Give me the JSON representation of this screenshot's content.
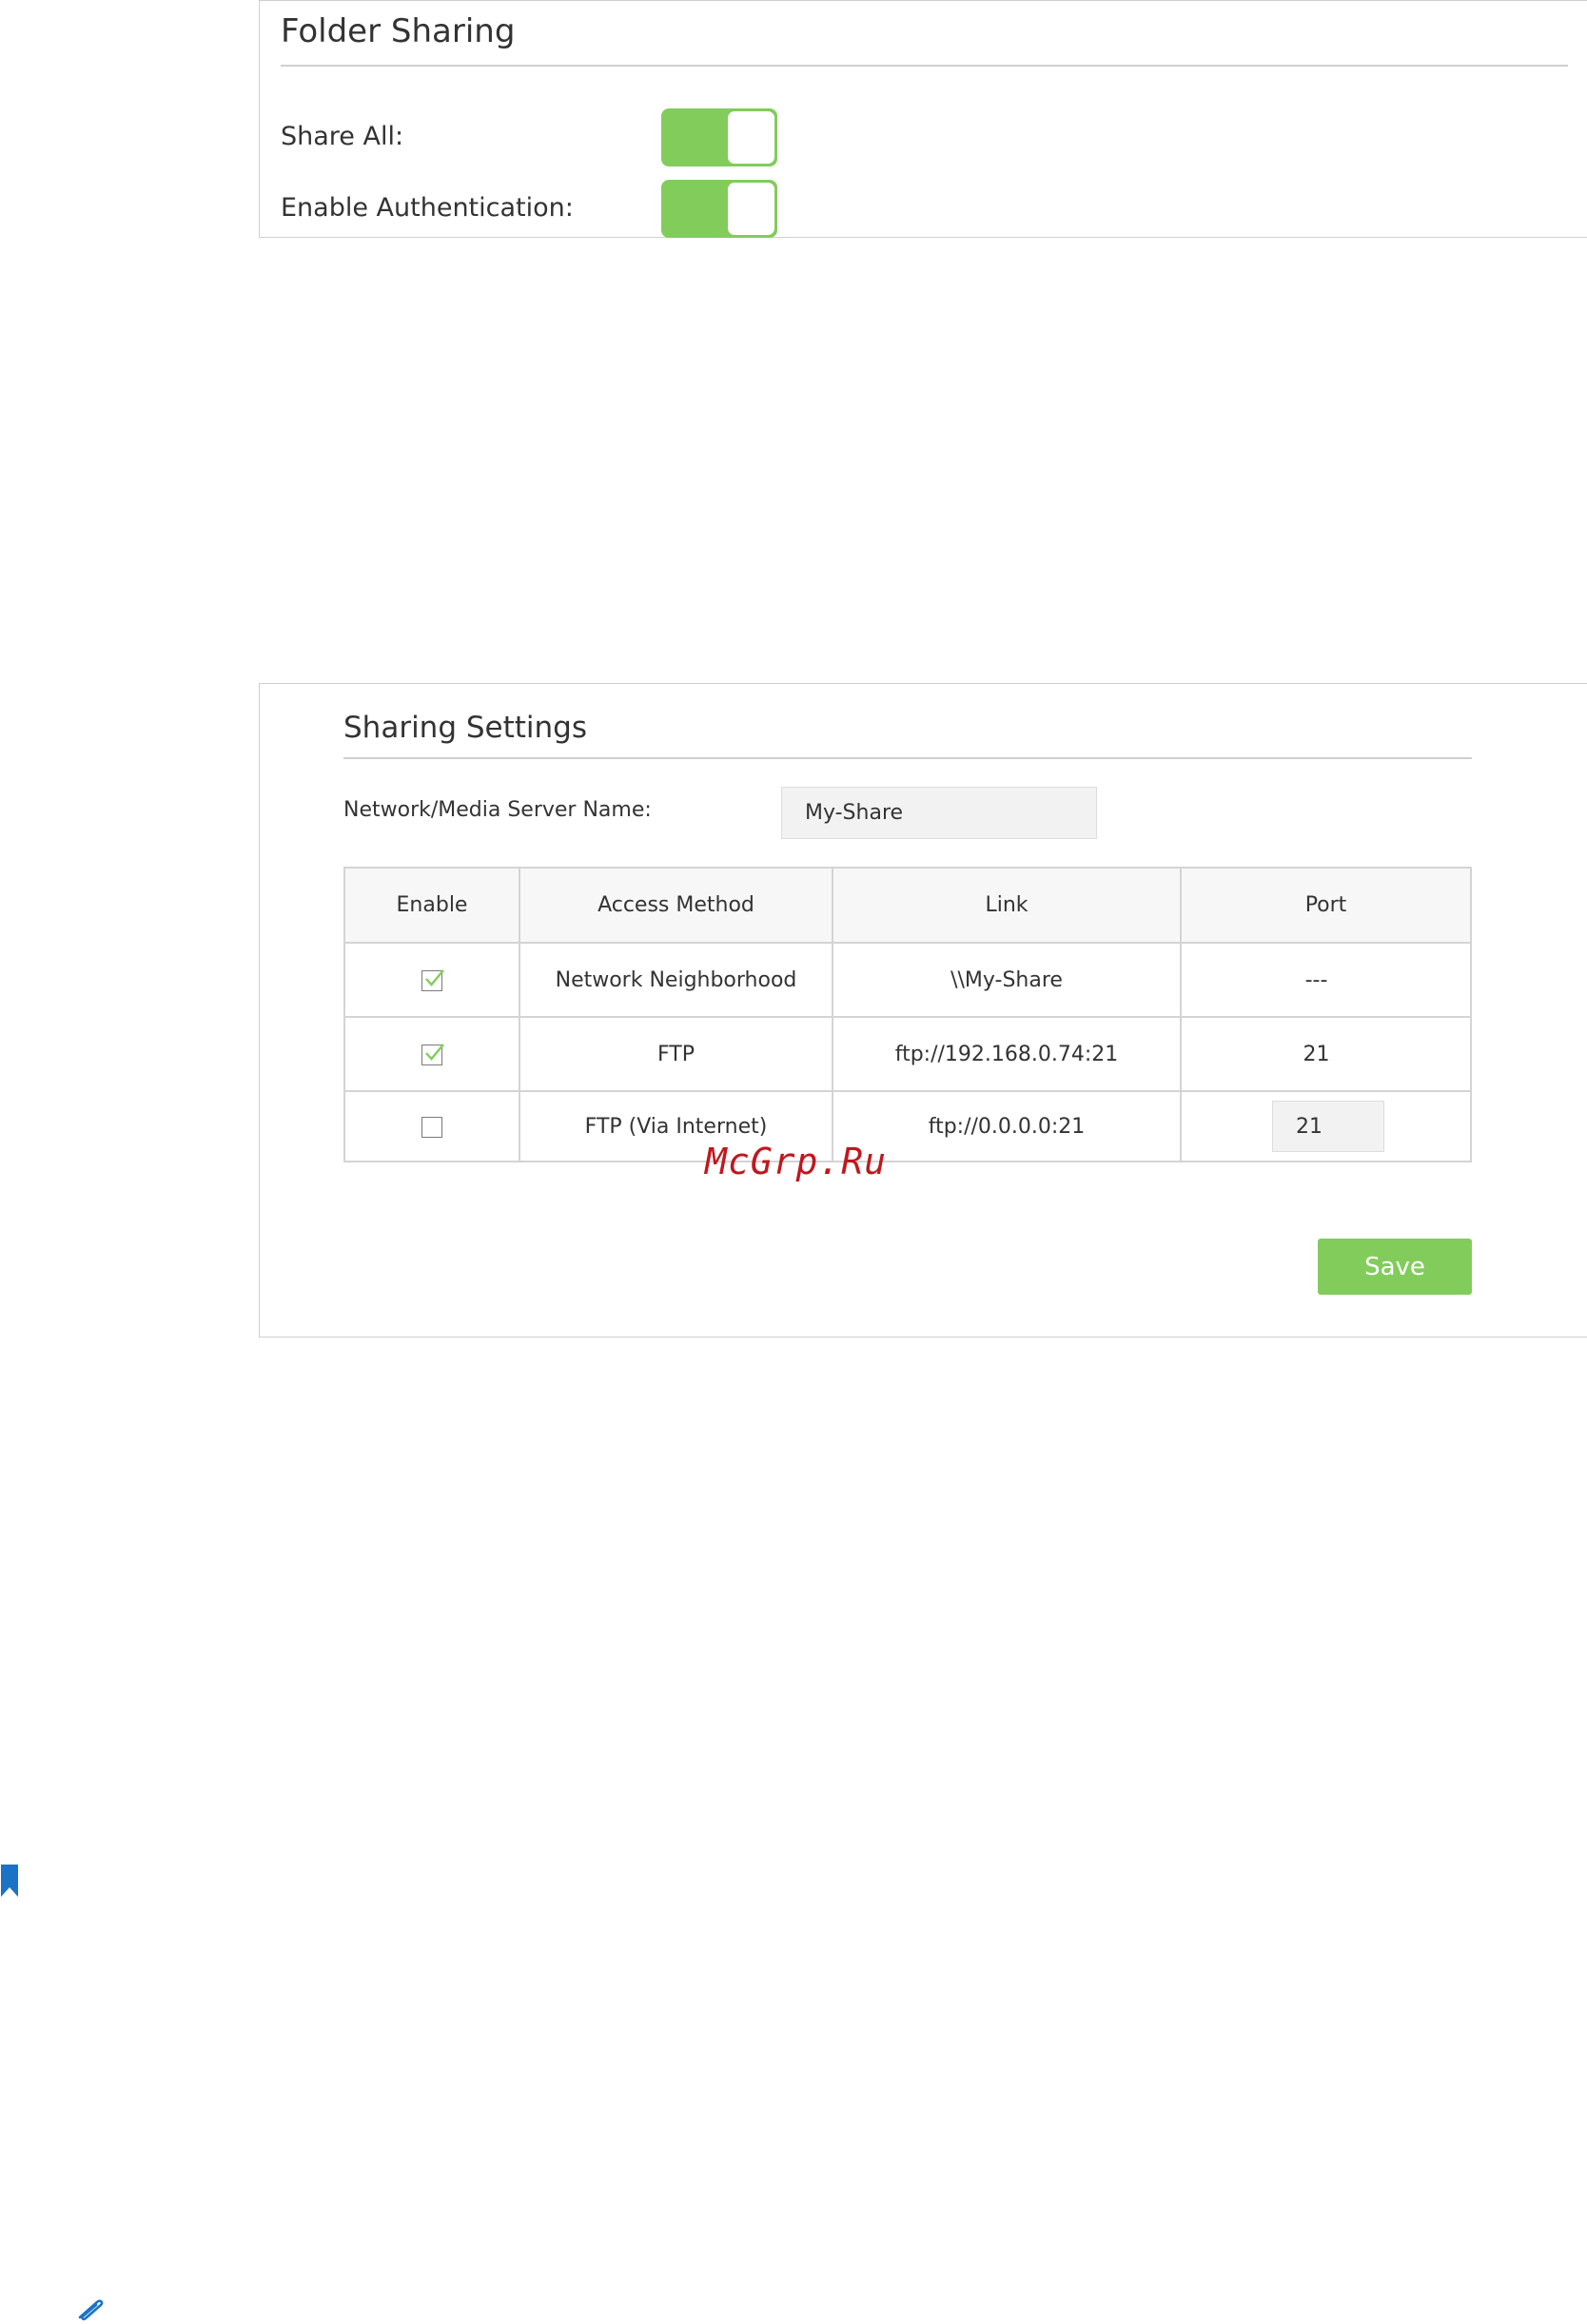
{
  "folder_sharing": {
    "title": "Folder Sharing",
    "share_all_label": "Share All:",
    "share_all_on": true,
    "auth_label": "Enable Authentication:",
    "auth_on": true
  },
  "sharing_settings": {
    "title": "Sharing Settings",
    "server_name_label": "Network/Media Server Name:",
    "server_name_value": "My-Share",
    "table": {
      "headers": [
        "Enable",
        "Access Method",
        "Link",
        "Port"
      ],
      "rows": [
        {
          "enabled": true,
          "method": "Network Neighborhood",
          "link": "\\\\My-Share",
          "port": "---",
          "port_editable": false
        },
        {
          "enabled": true,
          "method": "FTP",
          "link": "ftp://192.168.0.74:21",
          "port": "21",
          "port_editable": false
        },
        {
          "enabled": false,
          "method": "FTP (Via Internet)",
          "link": "ftp://0.0.0.0:21",
          "port": "21",
          "port_editable": true
        }
      ]
    },
    "save_label": "Save"
  },
  "watermark": "McGrp.Ru",
  "colors": {
    "accent_green": "#82cc5c",
    "watermark_red": "#c0171d",
    "icon_blue": "#1a73c6"
  },
  "icons": [
    "bookmark-icon",
    "attachment-icon",
    "checkmark-icon"
  ]
}
